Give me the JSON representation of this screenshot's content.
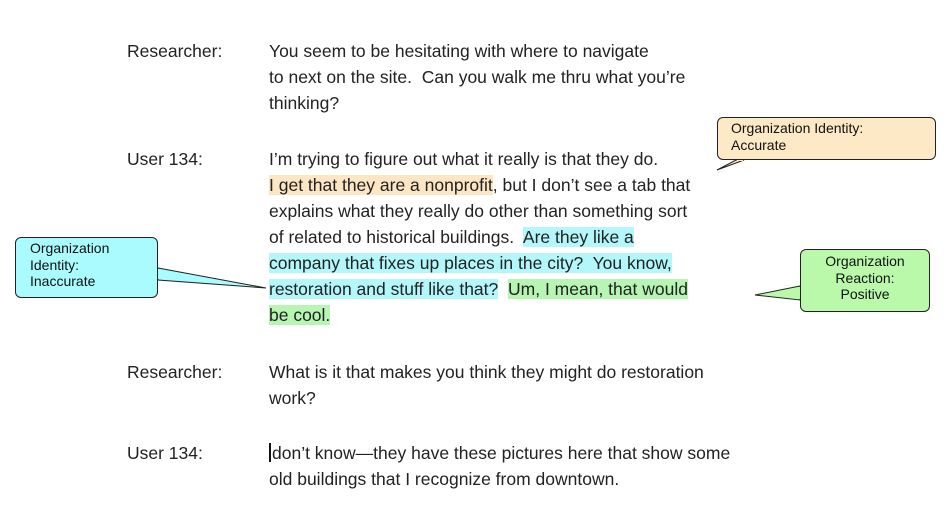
{
  "transcript": [
    {
      "speaker": "Researcher:",
      "lines": [
        "You seem to be hesitating with where to navigate",
        "to next on the site.  Can you walk me thru what you’re",
        "thinking?"
      ]
    },
    {
      "speaker": "User 134:",
      "segments": {
        "s1": "I’m trying to figure out what it really is that they do.",
        "s2": "I get that they are a nonprofit",
        "s3": ", but I don’t see a tab that",
        "s4": "explains what they really do other than something sort",
        "s5": "of related to historical buildings.  ",
        "s6": "Are they like a",
        "s7": "company that fixes up places in the city?  You know,",
        "s8": "restoration and stuff like that?",
        "s9": "  ",
        "s10": "Um, I mean, that would",
        "s11": "be cool."
      }
    },
    {
      "speaker": "Researcher:",
      "lines": [
        "What is it that makes you think they might do restoration",
        "work?"
      ]
    },
    {
      "speaker": "User 134:",
      "lines": [
        "don’t know—they have these pictures here that show some",
        "old buildings that I recognize from downtown."
      ]
    }
  ],
  "callouts": {
    "accurate": {
      "line1": "Organization Identity:",
      "line2": "Accurate"
    },
    "inaccurate": {
      "line1": "Organization",
      "line2": "Identity:",
      "line3": "Inaccurate"
    },
    "positive": {
      "line1": "Organization",
      "line2": "Reaction:",
      "line3": "Positive"
    }
  },
  "colors": {
    "highlight_accurate": "#fde6c4",
    "highlight_inaccurate": "#b3f7fb",
    "highlight_positive": "#b7f5b3"
  }
}
